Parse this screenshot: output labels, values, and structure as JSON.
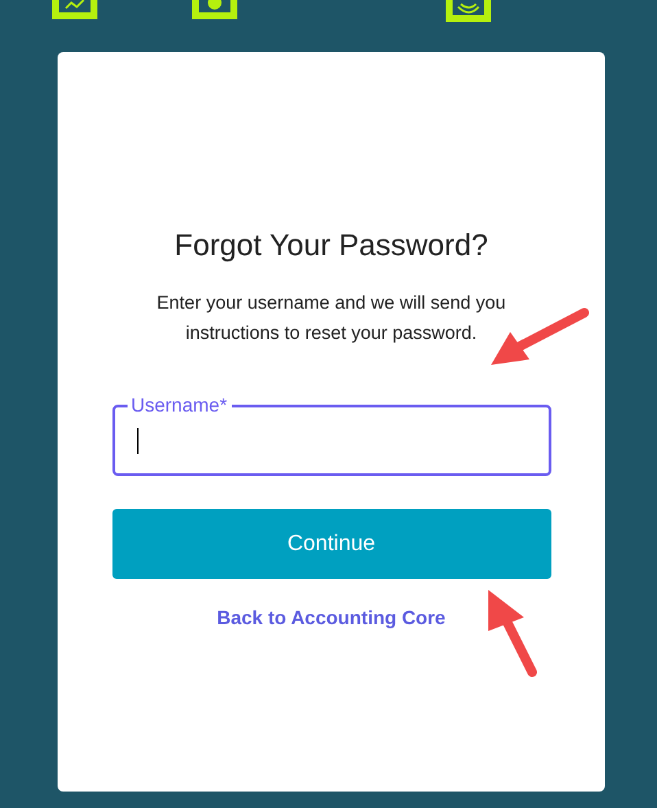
{
  "title": "Forgot Your Password?",
  "instructions": "Enter your username and we will send you instructions to reset your password.",
  "username_field": {
    "label": "Username*",
    "focused": true
  },
  "continue_button": "Continue",
  "back_link": "Back to Accounting Core"
}
